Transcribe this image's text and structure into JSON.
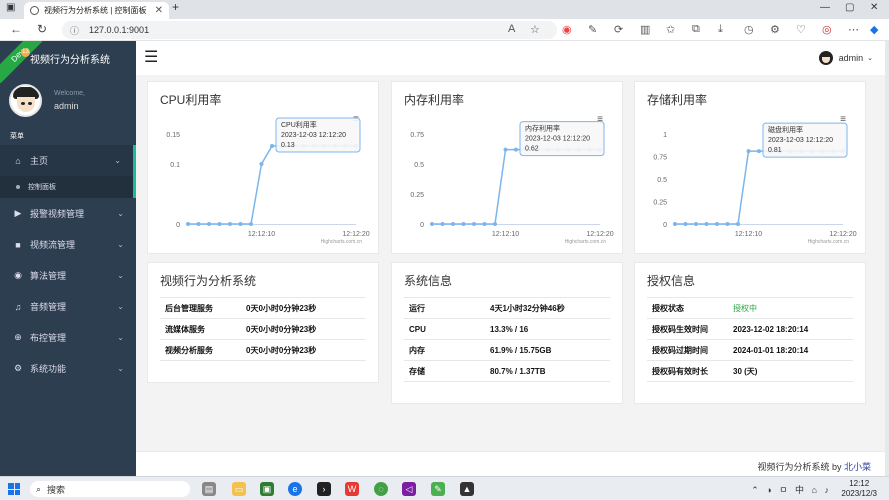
{
  "browser": {
    "tab_title": "视频行为分析系统 | 控制面板",
    "url": "127.0.0.1:9001"
  },
  "sidebar": {
    "ribbon": "Dev",
    "ribbon_badge": "13",
    "brand": "视频行为分析系统",
    "welcome": "Welcome,",
    "username": "admin",
    "menu_header": "菜单",
    "items": [
      {
        "label": "主页",
        "icon": "home-icon"
      },
      {
        "label": "报警视频管理",
        "icon": "video-icon"
      },
      {
        "label": "视频流管理",
        "icon": "camera-icon"
      },
      {
        "label": "算法管理",
        "icon": "eye-icon"
      },
      {
        "label": "音频管理",
        "icon": "music-icon"
      },
      {
        "label": "布控管理",
        "icon": "plus-circle-icon"
      },
      {
        "label": "系统功能",
        "icon": "gear-icon"
      }
    ],
    "subitem": "控制面板"
  },
  "topbar": {
    "username": "admin"
  },
  "cards": {
    "cpu_title": "CPU利用率",
    "mem_title": "内存利用率",
    "disk_title": "存储利用率",
    "app_title": "视频行为分析系统",
    "sys_title": "系统信息",
    "lic_title": "授权信息"
  },
  "app_rows": [
    {
      "k": "后台管理服务",
      "v": "0天0小时0分钟23秒"
    },
    {
      "k": "流媒体服务",
      "v": "0天0小时0分钟23秒"
    },
    {
      "k": "视频分析服务",
      "v": "0天0小时0分钟23秒"
    }
  ],
  "sys_rows": [
    {
      "k": "运行",
      "v": "4天1小时32分钟46秒"
    },
    {
      "k": "CPU",
      "v": "13.3% / 16"
    },
    {
      "k": "内存",
      "v": "61.9% / 15.75GB"
    },
    {
      "k": "存储",
      "v": "80.7% / 1.37TB"
    }
  ],
  "lic_rows": [
    {
      "k": "授权状态",
      "v": "授权中"
    },
    {
      "k": "授权码生效时间",
      "v": "2023-12-02 18:20:14"
    },
    {
      "k": "授权码过期时间",
      "v": "2024-01-01 18:20:14"
    },
    {
      "k": "授权码有效时长",
      "v": "30 (天)"
    }
  ],
  "footer": {
    "text": "视频行为分析系统 by ",
    "link": "北小菜"
  },
  "taskbar": {
    "search": "搜索",
    "ime": "中",
    "time": "12:12",
    "date": "2023/12/3"
  },
  "chart_data": [
    {
      "type": "line",
      "title": "CPU利用率",
      "x": [
        "",
        "",
        "",
        "",
        "",
        "",
        "",
        "12:12:10",
        "",
        "",
        "",
        "",
        "",
        "",
        "",
        "",
        "12:12:20"
      ],
      "xticks": [
        "12:12:10",
        "12:12:20"
      ],
      "yticks": [
        "0",
        "0.1",
        "0.15"
      ],
      "ylim": [
        0,
        0.15
      ],
      "values": [
        0,
        0,
        0,
        0,
        0,
        0,
        0,
        0.1,
        0.13,
        0.13,
        0.13,
        0.13,
        0.13,
        0.13,
        0.13,
        0.13,
        0.13
      ],
      "tooltip": {
        "title": "CPU利用率",
        "time": "2023-12-03 12:12:20",
        "value": "0.13"
      },
      "credits": "Highcharts.com.cn"
    },
    {
      "type": "line",
      "title": "内存利用率",
      "xticks": [
        "12:12:10",
        "12:12:20"
      ],
      "yticks": [
        "0",
        "0.25",
        "0.5",
        "0.75"
      ],
      "ylim": [
        0,
        0.75
      ],
      "values": [
        0,
        0,
        0,
        0,
        0,
        0,
        0,
        0.62,
        0.62,
        0.62,
        0.62,
        0.62,
        0.62,
        0.62,
        0.62,
        0.62,
        0.62
      ],
      "tooltip": {
        "title": "内存利用率",
        "time": "2023-12-03 12:12:20",
        "value": "0.62"
      },
      "credits": "Highcharts.com.cn"
    },
    {
      "type": "line",
      "title": "存储利用率",
      "xticks": [
        "12:12:10",
        "12:12:20"
      ],
      "yticks": [
        "0",
        "0.25",
        "0.5",
        "0.75",
        "1"
      ],
      "ylim": [
        0,
        1
      ],
      "values": [
        0,
        0,
        0,
        0,
        0,
        0,
        0,
        0.81,
        0.81,
        0.81,
        0.81,
        0.81,
        0.81,
        0.81,
        0.81,
        0.81,
        0.81
      ],
      "tooltip": {
        "title": "磁盘利用率",
        "time": "2023-12-03 12:12:20",
        "value": "0.81"
      },
      "credits": "Highcharts.com.cn"
    }
  ]
}
